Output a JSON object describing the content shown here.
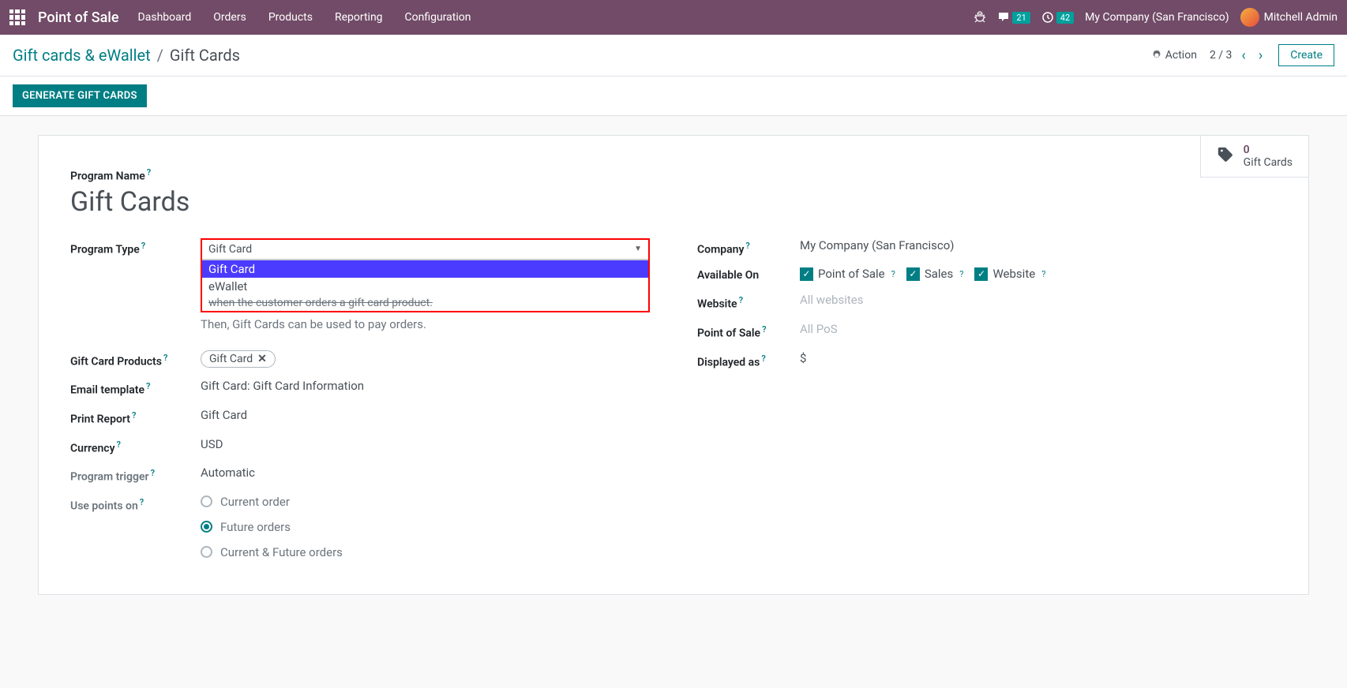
{
  "nav": {
    "brand": "Point of Sale",
    "items": [
      "Dashboard",
      "Orders",
      "Products",
      "Reporting",
      "Configuration"
    ],
    "msg_badge": "21",
    "activity_badge": "42",
    "company": "My Company (San Francisco)",
    "user": "Mitchell Admin"
  },
  "breadcrumb": {
    "parent": "Gift cards & eWallet",
    "current": "Gift Cards"
  },
  "controls": {
    "action_label": "Action",
    "pager": "2 / 3",
    "create_label": "Create"
  },
  "statusbar": {
    "generate_label": "GENERATE GIFT CARDS"
  },
  "stat": {
    "count": "0",
    "label": "Gift Cards"
  },
  "form": {
    "program_name_label": "Program Name",
    "program_name_value": "Gift Cards",
    "program_type_label": "Program Type",
    "program_type_selected": "Gift Card",
    "program_type_options": [
      "Gift Card",
      "eWallet"
    ],
    "program_type_ghost": "when the customer orders a gift card product.",
    "program_type_desc": "Then, Gift Cards can be used to pay orders.",
    "gift_card_products_label": "Gift Card Products",
    "gift_card_products_tag": "Gift Card",
    "email_template_label": "Email template",
    "email_template_value": "Gift Card: Gift Card Information",
    "print_report_label": "Print Report",
    "print_report_value": "Gift Card",
    "currency_label": "Currency",
    "currency_value": "USD",
    "program_trigger_label": "Program trigger",
    "program_trigger_value": "Automatic",
    "use_points_label": "Use points on",
    "use_points_options": [
      "Current order",
      "Future orders",
      "Current & Future orders"
    ],
    "use_points_selected": 1,
    "company_label": "Company",
    "company_value": "My Company (San Francisco)",
    "available_on_label": "Available On",
    "available_on_options": [
      "Point of Sale",
      "Sales",
      "Website"
    ],
    "website_label": "Website",
    "website_placeholder": "All websites",
    "pos_label": "Point of Sale",
    "pos_placeholder": "All PoS",
    "displayed_as_label": "Displayed as",
    "displayed_as_value": "$"
  }
}
